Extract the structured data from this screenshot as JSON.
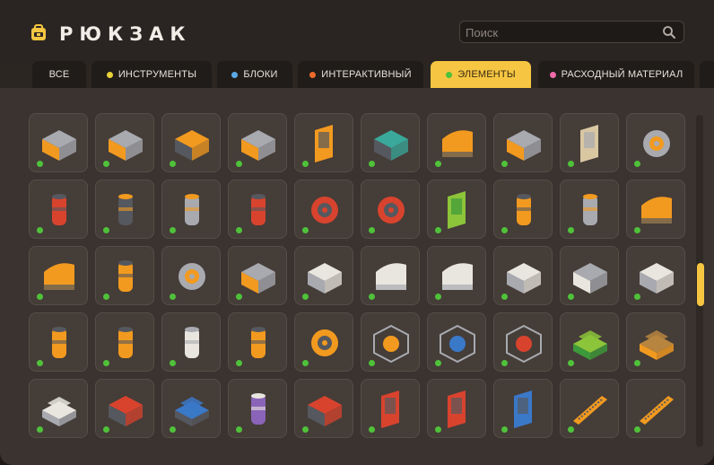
{
  "header": {
    "title": "РЮКЗАК",
    "search_placeholder": "Поиск"
  },
  "colors": {
    "accent": "#f6c642",
    "status_available": "#4fc23a"
  },
  "tabs": [
    {
      "label": "ВСЕ",
      "dot": null,
      "active": false
    },
    {
      "label": "ИНСТРУМЕНТЫ",
      "dot": "#e8d23a",
      "active": false
    },
    {
      "label": "БЛОКИ",
      "dot": "#5aa9e6",
      "active": false
    },
    {
      "label": "ИНТЕРАКТИВНЫЙ",
      "dot": "#ee6a2a",
      "active": false
    },
    {
      "label": "ЭЛЕМЕНТЫ",
      "dot": "#4fc23a",
      "active": true
    },
    {
      "label": "РАСХОДНЫЙ МАТЕРИАЛ",
      "dot": "#ee6aa8",
      "active": false
    }
  ],
  "items": [
    {
      "icon": "grey-orange-machine-block-icon"
    },
    {
      "icon": "grey-orange-machine-block-icon"
    },
    {
      "icon": "orange-grey-machine-block-icon"
    },
    {
      "icon": "grey-orange-machine-block-icon"
    },
    {
      "icon": "orange-door-panel-icon"
    },
    {
      "icon": "teal-container-icon"
    },
    {
      "icon": "orange-slope-block-icon"
    },
    {
      "icon": "hazard-stripe-block-icon"
    },
    {
      "icon": "beige-wall-panel-icon"
    },
    {
      "icon": "grey-valve-icon"
    },
    {
      "icon": "red-pipe-junction-icon"
    },
    {
      "icon": "dark-pipe-icon"
    },
    {
      "icon": "pipe-elbow-icon"
    },
    {
      "icon": "red-pipe-connector-icon"
    },
    {
      "icon": "red-hatch-icon"
    },
    {
      "icon": "red-engine-icon"
    },
    {
      "icon": "green-control-box-icon"
    },
    {
      "icon": "orange-barrel-icon"
    },
    {
      "icon": "glass-tank-icon"
    },
    {
      "icon": "orange-wedge-icon"
    },
    {
      "icon": "orange-glass-corner-icon"
    },
    {
      "icon": "orange-vent-cylinder-icon"
    },
    {
      "icon": "grey-hatch-wheel-icon"
    },
    {
      "icon": "grey-vent-panel-icon"
    },
    {
      "icon": "white-cube-icon"
    },
    {
      "icon": "white-slope-icon"
    },
    {
      "icon": "white-curve-icon"
    },
    {
      "icon": "white-box-icon"
    },
    {
      "icon": "perforated-panel-icon"
    },
    {
      "icon": "white-grille-icon"
    },
    {
      "icon": "orange-spool-icon"
    },
    {
      "icon": "orange-pole-icon"
    },
    {
      "icon": "white-curved-pipe-icon"
    },
    {
      "icon": "orange-drum-icon"
    },
    {
      "icon": "orange-ball-joint-icon"
    },
    {
      "icon": "wire-cage-orange-icon"
    },
    {
      "icon": "wire-cage-blue-icon"
    },
    {
      "icon": "wire-cage-red-icon"
    },
    {
      "icon": "green-sandbag-icon"
    },
    {
      "icon": "cardboard-box-stack-icon"
    },
    {
      "icon": "white-box-stack-icon"
    },
    {
      "icon": "red-machine-icon"
    },
    {
      "icon": "blue-stacked-block-icon"
    },
    {
      "icon": "purple-canister-icon"
    },
    {
      "icon": "red-dynamite-icon"
    },
    {
      "icon": "red-poster-icon"
    },
    {
      "icon": "red-poster-icon"
    },
    {
      "icon": "blue-poster-icon"
    },
    {
      "icon": "orange-rail-icon"
    },
    {
      "icon": "orange-rail-icon"
    }
  ]
}
